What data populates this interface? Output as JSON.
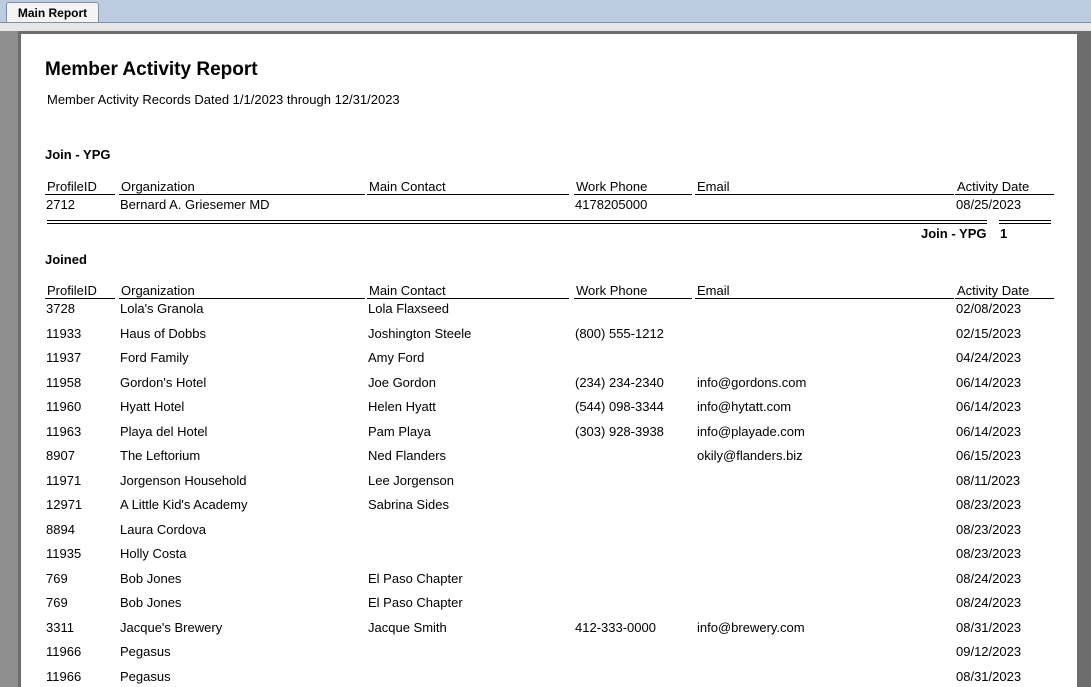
{
  "tab": {
    "label": "Main Report"
  },
  "report": {
    "title": "Member Activity Report",
    "subtitle": "Member Activity Records Dated 1/1/2023 through 12/31/2023"
  },
  "columns": [
    "ProfileID",
    "Organization",
    "Main Contact",
    "Work Phone",
    "Email",
    "Activity Date"
  ],
  "groups": [
    {
      "name": "Join - YPG",
      "total_label": "Join - YPG",
      "total_count": "1",
      "rows": [
        [
          "2712",
          "Bernard A. Griesemer MD",
          "",
          "4178205000",
          "",
          "08/25/2023"
        ]
      ]
    },
    {
      "name": "Joined",
      "rows": [
        [
          "3728",
          "Lola's Granola",
          "Lola Flaxseed",
          "",
          "",
          "02/08/2023"
        ],
        [
          "11933",
          "Haus of Dobbs",
          "Joshington Steele",
          "(800) 555-1212",
          "",
          "02/15/2023"
        ],
        [
          "11937",
          "Ford Family",
          "Amy Ford",
          "",
          "",
          "04/24/2023"
        ],
        [
          "11958",
          "Gordon's Hotel",
          "Joe Gordon",
          "(234) 234-2340",
          "info@gordons.com",
          "06/14/2023"
        ],
        [
          "11960",
          "Hyatt Hotel",
          "Helen Hyatt",
          "(544) 098-3344",
          "info@hytatt.com",
          "06/14/2023"
        ],
        [
          "11963",
          "Playa del Hotel",
          "Pam Playa",
          "(303) 928-3938",
          "info@playade.com",
          "06/14/2023"
        ],
        [
          "8907",
          "The Leftorium",
          "Ned Flanders",
          "",
          "okily@flanders.biz",
          "06/15/2023"
        ],
        [
          "11971",
          "Jorgenson Household",
          "Lee Jorgenson",
          "",
          "",
          "08/11/2023"
        ],
        [
          "12971",
          "A Little Kid's Academy",
          "Sabrina Sides",
          "",
          "",
          "08/23/2023"
        ],
        [
          "8894",
          "Laura Cordova",
          "",
          "",
          "",
          "08/23/2023"
        ],
        [
          "11935",
          "Holly Costa",
          "",
          "",
          "",
          "08/23/2023"
        ],
        [
          "769",
          "Bob Jones",
          "El Paso Chapter",
          "",
          "",
          "08/24/2023"
        ],
        [
          "769",
          "Bob Jones",
          "El Paso Chapter",
          "",
          "",
          "08/24/2023"
        ],
        [
          "3311",
          "Jacque's Brewery",
          "Jacque Smith",
          "412-333-0000",
          "info@brewery.com",
          "08/31/2023"
        ],
        [
          "11966",
          "Pegasus",
          "",
          "",
          "",
          "09/12/2023"
        ],
        [
          "11966",
          "Pegasus",
          "",
          "",
          "",
          "08/31/2023"
        ]
      ]
    }
  ]
}
